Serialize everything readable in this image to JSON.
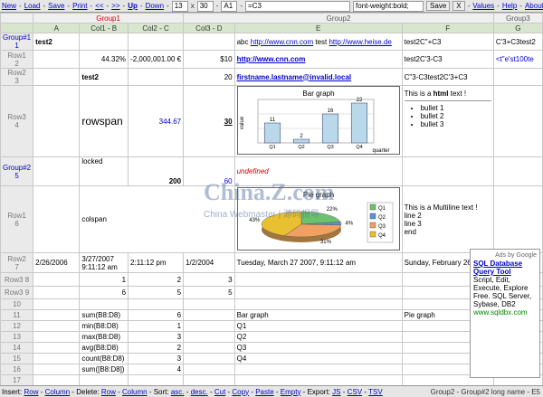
{
  "toolbar": {
    "new": "New",
    "load": "Load",
    "save": "Save",
    "print": "Print",
    "prev_all": "<<",
    "prev": "-",
    "next": ">>",
    "up": "Up",
    "down": "Down",
    "row_value": "13",
    "col_value": "30",
    "cell_ref": "A1",
    "formula_value": "=C3",
    "style_value": "font-weight:bold;",
    "save_btn": "Save",
    "x_btn": "X",
    "values": "Values",
    "help": "Help",
    "about": "About"
  },
  "groups": {
    "g1": "Group1",
    "g2": "Group2",
    "g3": "Group3"
  },
  "columns": [
    "A",
    "Col1 - B",
    "Col2 - C",
    "Col3 - D",
    "E",
    "F",
    "G"
  ],
  "rowheads": {
    "r1": [
      "Group#1",
      "1"
    ],
    "r2": [
      "Row1",
      "2"
    ],
    "r3": [
      "Row2",
      "3"
    ],
    "r4": [
      "Row3",
      "4"
    ],
    "r5": [
      "Group#2",
      "5"
    ],
    "r6": [
      "Row1",
      "6"
    ],
    "r7": [
      "Row2",
      "7"
    ],
    "r8": [
      "Row3",
      "8"
    ],
    "r9": [
      "Row3",
      "9"
    ]
  },
  "cells": {
    "A1": "test2",
    "E1_a": "abc",
    "E1_l1": "http://www.cnn.com",
    "E1_b": "test",
    "E1_l2": "http://www.heise.de",
    "F1": "test2C\"+C3",
    "G1": "C'3+C3test2",
    "B2": "44.32%",
    "C2": "-2,000,001.00 €",
    "D2": "$10",
    "E2": "http://www.cnn.com",
    "F2": "test2C'3-C3",
    "G2": "<t\"e'st100te",
    "B3": "test2",
    "D3": "20",
    "E3": "firstname.lastname@invalid.local",
    "F3": "C\"3-C3test2C'3+C3",
    "B4": "rowspan",
    "C4": "344.67",
    "D4": "30",
    "F4_pre": "This is a ",
    "F4_html": "html",
    "F4_post": " text !",
    "F4_bullets": [
      "bullet 1",
      "bullet 2",
      "bullet 3"
    ],
    "B5a": "locked",
    "C5": "200",
    "D5": "60",
    "E5": "undefined",
    "B6": "colspan",
    "F6": [
      "This is a Multiline text !",
      "line 2",
      "line 3",
      "end"
    ],
    "A7": "2/26/2006",
    "B7": [
      "3/27/2007",
      "9:11:12 am"
    ],
    "C7": "2:11:12 pm",
    "D7": "1/2/2004",
    "E7": "Tuesday, March 27 2007, 9:11:12 am",
    "F7": "Sunday, February 26"
  },
  "rows_lower": [
    {
      "n": "8",
      "B": "1",
      "C": "2",
      "D": "3",
      "E": "",
      "F": ""
    },
    {
      "n": "9",
      "B": "6",
      "C": "5",
      "D": "5",
      "E": "",
      "F": ""
    },
    {
      "n": "10",
      "B": "",
      "C": "",
      "D": "",
      "E": "",
      "F": ""
    },
    {
      "n": "11",
      "B": "sum(B8:D8)",
      "C": "6",
      "D": "",
      "E": "Bar graph",
      "F": "Pie graph"
    },
    {
      "n": "12",
      "B": "min(B8:D8)",
      "C": "1",
      "D": "",
      "E": "Q1",
      "F": ""
    },
    {
      "n": "13",
      "B": "max(B8:D8)",
      "C": "3",
      "D": "",
      "E": "Q2",
      "F": ""
    },
    {
      "n": "14",
      "B": "avg(B8:D8)",
      "C": "2",
      "D": "",
      "E": "Q3",
      "F": ""
    },
    {
      "n": "15",
      "B": "count(B8:D8)",
      "C": "3",
      "D": "",
      "E": "Q4",
      "F": ""
    },
    {
      "n": "16",
      "B": "sum([B8:D8])",
      "C": "4",
      "D": "",
      "E": "",
      "F": ""
    },
    {
      "n": "17",
      "B": "",
      "C": "",
      "D": "",
      "E": "",
      "F": ""
    }
  ],
  "charts": {
    "bar_title": "Bar graph",
    "bar_ylabel": "value",
    "bar_xlabel": "quarter",
    "pie_title": "Pie graph"
  },
  "chart_data": [
    {
      "type": "bar",
      "title": "Bar graph",
      "xlabel": "quarter",
      "ylabel": "value",
      "categories": [
        "Q1",
        "Q2",
        "Q3",
        "Q4"
      ],
      "values": [
        11,
        2,
        16,
        22
      ],
      "ylim": [
        0,
        24
      ],
      "grid": true
    },
    {
      "type": "pie",
      "title": "Pie graph",
      "labels": [
        "Q1",
        "Q2",
        "Q3",
        "Q4"
      ],
      "values": [
        22,
        4,
        31,
        43
      ],
      "percent_labels": [
        "22%",
        "4%",
        "31%",
        "43%"
      ],
      "colors": [
        "#6cc26c",
        "#5b8fd6",
        "#f0a060",
        "#e8c030"
      ],
      "legend": "right"
    }
  ],
  "ad": {
    "header": "Ads by Google",
    "title": "SQL Database Query Tool",
    "body": "Script, Edit, Execute, Explore Free. SQL Server, Sybase, DB2",
    "url": "www.sqldbx.com"
  },
  "watermark": {
    "brand": "China.Z.com",
    "sub": "China Webmaster | 源码报导"
  },
  "status": {
    "insert": "Insert:",
    "row": "Row",
    "column": "Column",
    "delete": "Delete:",
    "sort": "Sort:",
    "asc": "asc.",
    "desc": "desc.",
    "cut": "Cut",
    "copy": "Copy",
    "paste": "Paste",
    "empty": "Empty",
    "export": "Export:",
    "js": "JS",
    "csv": "CSV",
    "tsv": "TSV",
    "right_text": "Group2 - Group#2 long name - E5"
  }
}
